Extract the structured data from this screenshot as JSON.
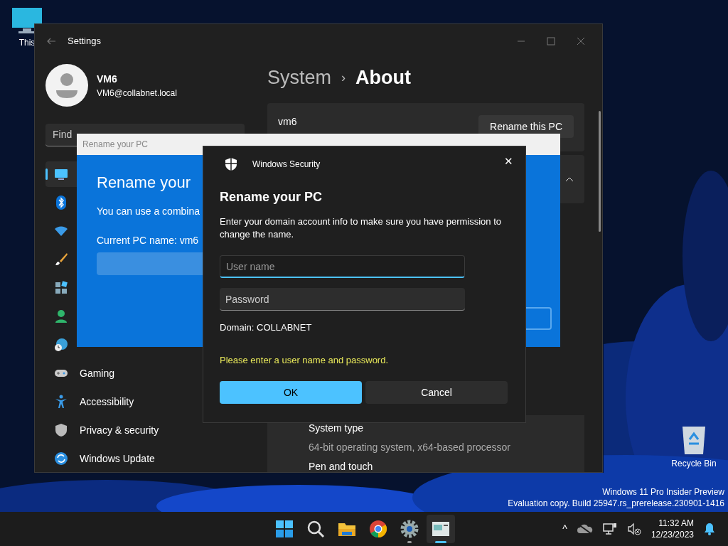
{
  "desktop_icons": [
    {
      "kind": "pc",
      "label": "This"
    },
    {
      "kind": "bin",
      "label": "Recycle Bin"
    }
  ],
  "settings": {
    "title": "Settings",
    "user": {
      "name": "VM6",
      "email": "VM6@collabnet.local"
    },
    "search": {
      "placeholder": "Find"
    },
    "nav": [
      {
        "kind": "system",
        "selected": true
      },
      {
        "kind": "bluetooth",
        "selected": false
      },
      {
        "kind": "network",
        "selected": false
      },
      {
        "kind": "personalization",
        "selected": false
      },
      {
        "kind": "apps",
        "selected": false
      },
      {
        "kind": "accounts",
        "selected": false
      },
      {
        "kind": "time",
        "selected": false
      },
      {
        "kind": "gaming",
        "label": "Gaming",
        "selected": false
      },
      {
        "kind": "accessibility",
        "label": "Accessibility",
        "selected": false
      },
      {
        "kind": "privacy",
        "label": "Privacy & security",
        "selected": false
      },
      {
        "kind": "update",
        "label": "Windows Update",
        "selected": false
      }
    ],
    "breadcrumb": {
      "parent": "System",
      "separator": "›",
      "current": "About"
    },
    "device": {
      "name": "vm6",
      "button": "Rename this PC"
    },
    "specs": [
      {
        "label": "System type",
        "value": "64-bit operating system, x64-based processor"
      },
      {
        "label": "Pen and touch"
      }
    ]
  },
  "rename_dialog": {
    "title": "Rename your PC",
    "heading": "Rename your",
    "text": "You can use a combina",
    "current": "Current PC name: vm6"
  },
  "security_dialog": {
    "app": "Windows Security",
    "close": "✕",
    "title": "Rename your PC",
    "message": "Enter your domain account info to make sure you have permission to change the name.",
    "fields": [
      {
        "placeholder": "User name",
        "focused": true
      },
      {
        "placeholder": "Password",
        "focused": false
      }
    ],
    "domain": "Domain: COLLABNET",
    "error": "Please enter a user name and password.",
    "buttons": [
      {
        "label": "OK",
        "primary": true
      },
      {
        "label": "Cancel",
        "primary": false
      }
    ]
  },
  "desktop_notice": [
    "Windows 11 Pro Insider Preview",
    "Evaluation copy. Build 25947.rs_prerelease.230901-1416"
  ],
  "taskbar": {
    "apps": [
      {
        "kind": "start",
        "running": false,
        "active": false
      },
      {
        "kind": "search",
        "running": false,
        "active": false
      },
      {
        "kind": "explorer",
        "running": false,
        "active": false
      },
      {
        "kind": "chrome",
        "running": false,
        "active": false
      },
      {
        "kind": "settings",
        "running": true,
        "active": false
      },
      {
        "kind": "window",
        "running": true,
        "active": true
      }
    ],
    "tray_chevron": "^",
    "time": "11:32 AM",
    "date": "12/23/2023"
  }
}
